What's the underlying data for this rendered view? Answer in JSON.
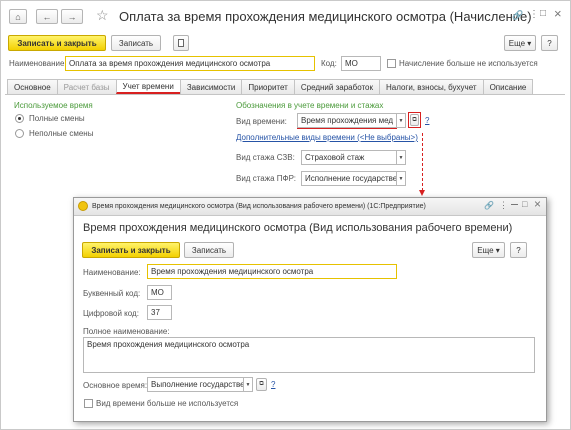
{
  "main": {
    "title": "Оплата за время прохождения медицинского осмотра (Начисление)",
    "nav": {
      "home": "⌂",
      "back": "←",
      "forward": "→",
      "star": "☆"
    },
    "window_controls": {
      "link": "🔗",
      "menu": "⋮",
      "maximize": "□",
      "close": "×"
    },
    "toolbar": {
      "save_close": "Записать и закрыть",
      "save": "Записать",
      "more": "Еще ▾",
      "help": "?"
    },
    "name_label": "Наименование:",
    "name_value": "Оплата за время прохождения медицинского осмотра",
    "code_label": "Код:",
    "code_value": "МО",
    "unused_label": "Начисление больше не используется",
    "tabs": [
      "Основное",
      "Расчет базы",
      "Учет времени",
      "Зависимости",
      "Приоритет",
      "Средний заработок",
      "Налоги, взносы, бухучет",
      "Описание"
    ],
    "time_section": {
      "used_time_header": "Используемое время",
      "full_shifts": "Полные смены",
      "partial_shifts": "Неполные смены",
      "designations_header": "Обозначения в учете времени и стажах",
      "time_type_label": "Вид времени:",
      "time_type_value": "Время прохождения мед",
      "extra_link": "Дополнительные виды времени (<Не выбраны>)",
      "szv_label": "Вид стажа СЗВ:",
      "szv_value": "Страховой стаж",
      "pfr_label": "Вид стажа ПФР:",
      "pfr_value": "Исполнение государстве"
    }
  },
  "sub": {
    "window_title": "Время прохождения медицинского осмотра (Вид использования рабочего времени)  (1С:Предприятие)",
    "heading": "Время прохождения медицинского осмотра (Вид использования рабочего времени)",
    "toolbar": {
      "save_close": "Записать и закрыть",
      "save": "Записать",
      "more": "Еще ▾",
      "help": "?"
    },
    "name_label": "Наименование:",
    "name_value": "Время прохождения медицинского осмотра",
    "letter_code_label": "Буквенный код:",
    "letter_code_value": "МО",
    "digit_code_label": "Цифровой код:",
    "digit_code_value": "37",
    "full_name_label": "Полное наименование:",
    "full_name_value": "Время прохождения медицинского осмотра",
    "main_time_label": "Основное время:",
    "main_time_value": "Выполнение государстве",
    "unused_label": "Вид времени больше не используется"
  },
  "colors": {
    "accent_yellow": "#f3d000",
    "highlight_red": "#d82020",
    "section_green": "#4a9a3a",
    "link_blue": "#2653a6"
  }
}
